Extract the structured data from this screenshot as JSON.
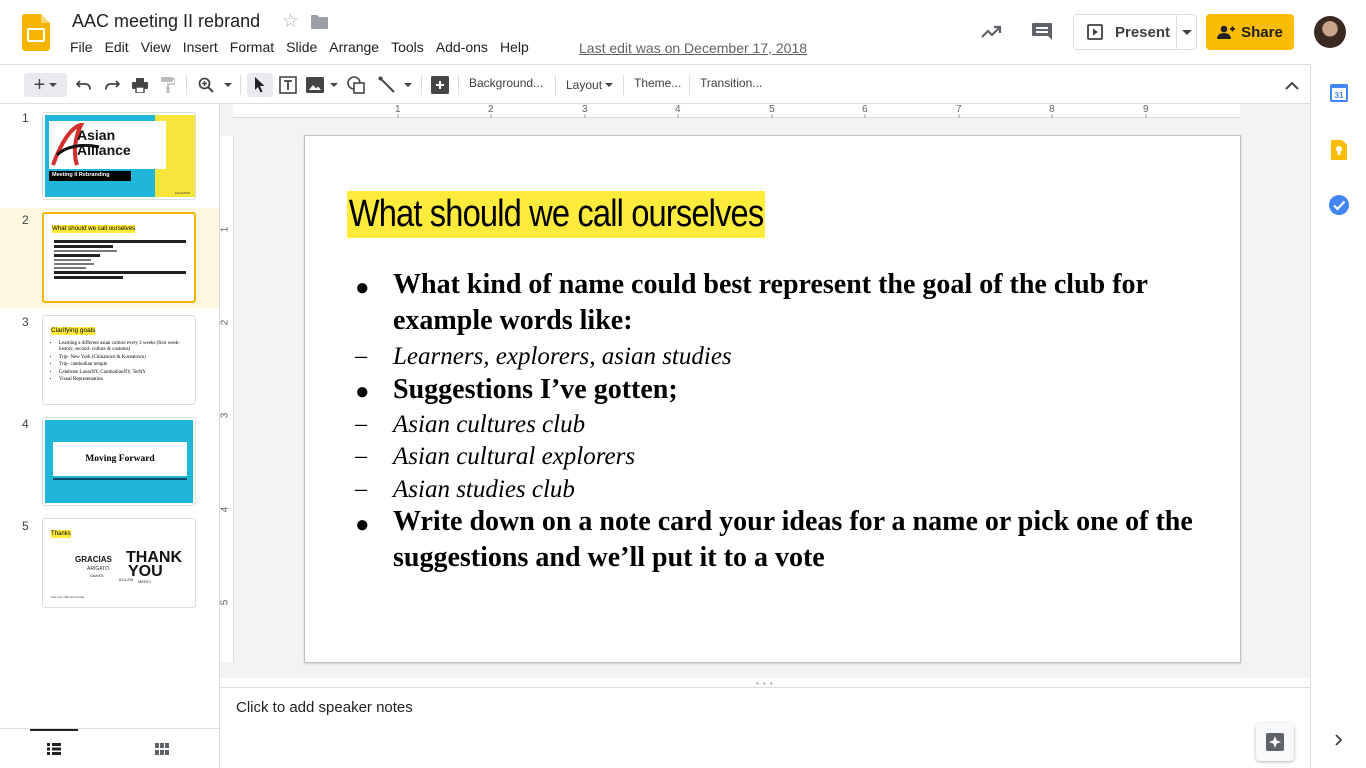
{
  "app": {
    "doc_title": "AAC meeting II rebrand",
    "last_edit": "Last edit was on December 17, 2018",
    "menu": [
      "File",
      "Edit",
      "View",
      "Insert",
      "Format",
      "Slide",
      "Arrange",
      "Tools",
      "Add-ons",
      "Help"
    ],
    "present_label": "Present",
    "share_label": "Share",
    "brand_color": "#f4b400",
    "share_color": "#fbbc04"
  },
  "toolbar": {
    "background_label": "Background...",
    "layout_label": "Layout",
    "theme_label": "Theme...",
    "transition_label": "Transition..."
  },
  "ruler": {
    "h_ticks": [
      "1",
      "2",
      "3",
      "4",
      "5",
      "6",
      "7",
      "8",
      "9"
    ],
    "v_ticks": [
      "1",
      "2",
      "3",
      "4",
      "5"
    ]
  },
  "filmstrip": {
    "selected": 2,
    "slides": [
      {
        "num": "1",
        "logo_text": "Asian Alliance",
        "caption": "Meeting II Rebranding",
        "small": "12/11/2018"
      },
      {
        "num": "2",
        "title": "What should we call ourselves"
      },
      {
        "num": "3",
        "title": "Clarifying goals",
        "items": [
          "Learning a different asian culture every 2 weeks (first week- history, second- culture & customs)",
          "Trip- New York (Chinatown & Koreatown)",
          "Trip- cambodian temple",
          "Celebrate LunarNY, CambodianNY, TetNY",
          "Visual Representation"
        ]
      },
      {
        "num": "4",
        "title": "Moving Forward"
      },
      {
        "num": "5",
        "title": "Thanks",
        "words": [
          "GRACIAS",
          "THANK",
          "YOU",
          "ARIGATO",
          "MERCI",
          "DANKE",
          "BOLZIN"
        ],
        "footer": "See you after the break!"
      }
    ]
  },
  "slide": {
    "title": "What should we call ourselves",
    "bullets": [
      {
        "marker": "●",
        "style": "bold",
        "text": "What kind of name could best represent the goal of the club for example words like:"
      },
      {
        "marker": "–",
        "style": "italic",
        "text": "Learners, explorers, asian studies"
      },
      {
        "marker": "●",
        "style": "bold",
        "text": "Suggestions I’ve gotten;"
      },
      {
        "marker": "–",
        "style": "italic",
        "text": "Asian cultures club"
      },
      {
        "marker": "–",
        "style": "italic",
        "text": "Asian cultural explorers"
      },
      {
        "marker": "–",
        "style": "italic",
        "text": "Asian studies club"
      },
      {
        "marker": "●",
        "style": "bold",
        "text": "Write down on a note card your ideas for a name or pick one of the suggestions and we’ll put it to a vote"
      }
    ],
    "title_highlight_color": "#ffeb3b"
  },
  "notes": {
    "placeholder": "Click to add speaker notes"
  },
  "icons": [
    "slides-logo-icon",
    "star-icon",
    "folder-icon",
    "trending-icon",
    "comment-icon",
    "present-icon",
    "share-person-icon",
    "calendar-icon",
    "keep-icon",
    "tasks-icon",
    "explore-icon",
    "chevron-right-icon"
  ]
}
